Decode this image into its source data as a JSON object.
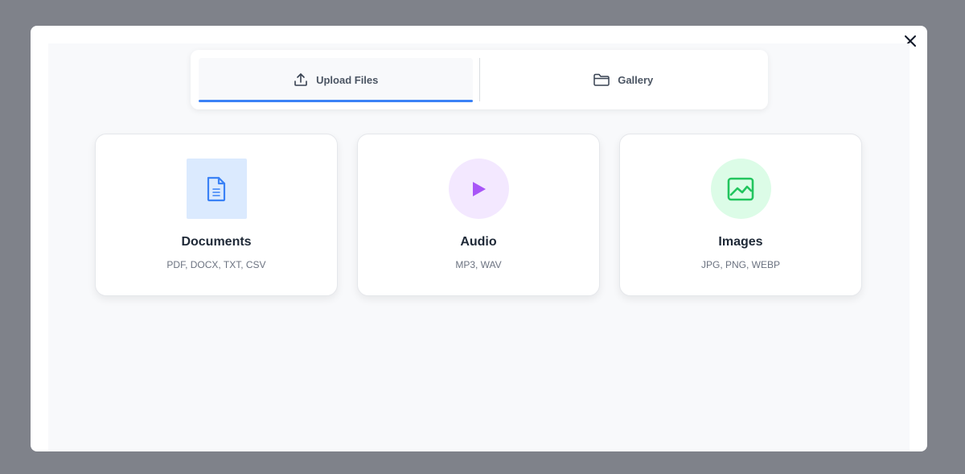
{
  "tabs": [
    {
      "label": "Upload Files",
      "icon": "upload-icon",
      "active": true
    },
    {
      "label": "Gallery",
      "icon": "folder-icon",
      "active": false
    }
  ],
  "cards": [
    {
      "title": "Documents",
      "formats": "PDF, DOCX, TXT, CSV",
      "icon": "document-icon",
      "color": "#3b82f6"
    },
    {
      "title": "Audio",
      "formats": "MP3, WAV",
      "icon": "play-icon",
      "color": "#a855f7"
    },
    {
      "title": "Images",
      "formats": "JPG, PNG, WEBP",
      "icon": "image-icon",
      "color": "#22c55e"
    }
  ],
  "colors": {
    "accent": "#3b82f6",
    "overlay": "#7f828a"
  }
}
